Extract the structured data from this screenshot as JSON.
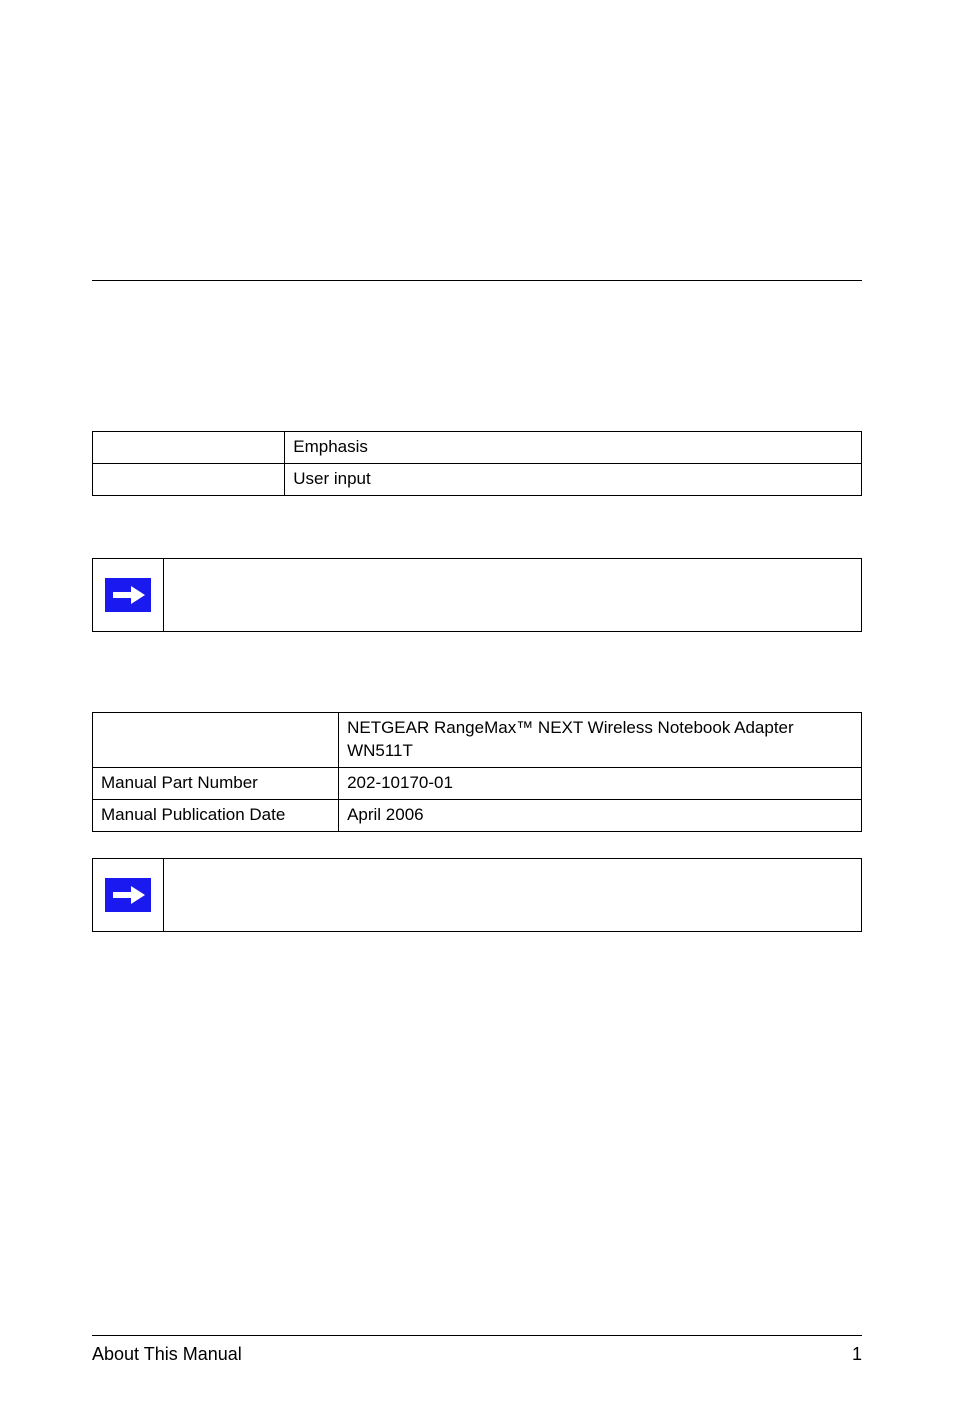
{
  "table1": {
    "rows": [
      {
        "col1": "",
        "col2": "Emphasis"
      },
      {
        "col1": "",
        "col2": "User input"
      }
    ]
  },
  "note1": {
    "icon": "arrow-right-icon"
  },
  "table2": {
    "rows": [
      {
        "col1": "",
        "col2": "NETGEAR RangeMax™ NEXT Wireless Notebook Adapter WN511T"
      },
      {
        "col1": "Manual Part Number",
        "col2": "202-10170-01"
      },
      {
        "col1": "Manual Publication Date",
        "col2": "April 2006"
      }
    ]
  },
  "note2": {
    "icon": "arrow-right-icon"
  },
  "footer": {
    "left": "About This Manual",
    "right": "1"
  }
}
